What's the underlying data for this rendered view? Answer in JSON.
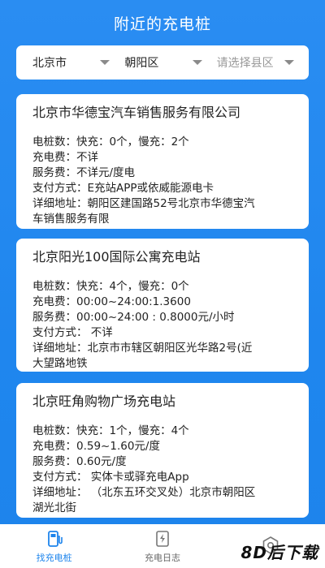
{
  "header": {
    "title": "附近的充电桩"
  },
  "filters": [
    {
      "label": "北京市"
    },
    {
      "label": "朝阳区"
    },
    {
      "label": "请选择县区"
    }
  ],
  "stations": [
    {
      "title": "北京市华德宝汽车销售服务有限公司",
      "rows": [
        "电桩数：快充：0个，慢充：2个",
        "充电费：不详",
        "服务费：不详元/度电",
        "支付方式：E充站APP或依威能源电卡",
        "详细地址：朝阳区建国路52号北京市华德宝汽",
        "车销售服务有限"
      ]
    },
    {
      "title": "北京阳光100国际公寓充电站",
      "rows": [
        "电桩数：快充：4个，慢充：0个",
        "充电费：00:00~24:00:1.3600",
        "服务费：00:00~24:00 : 0.8000元/小时",
        "支付方式： 不详",
        "详细地址：北京市市辖区朝阳区光华路2号(近",
        "大望路地铁"
      ]
    },
    {
      "title": "北京旺角购物广场充电站",
      "rows": [
        "电桩数：快充：1个，慢充：4个",
        "充电费：0.59~1.60元/度",
        "服务费：0.60元/度",
        "支付方式： 实体卡或驿充电App",
        "详细地址： （北东五环交叉处）北京市朝阳区",
        "湖光北街"
      ]
    }
  ],
  "tabs": [
    {
      "label": "找充电桩",
      "icon": "charging-station-icon",
      "active": true
    },
    {
      "label": "充电日志",
      "icon": "charge-log-icon",
      "active": false
    },
    {
      "label": "",
      "icon": "settings-icon",
      "active": false
    }
  ],
  "watermark": "8D后下载",
  "colors": {
    "accent": "#1d84ec",
    "background": "#2189ef"
  }
}
